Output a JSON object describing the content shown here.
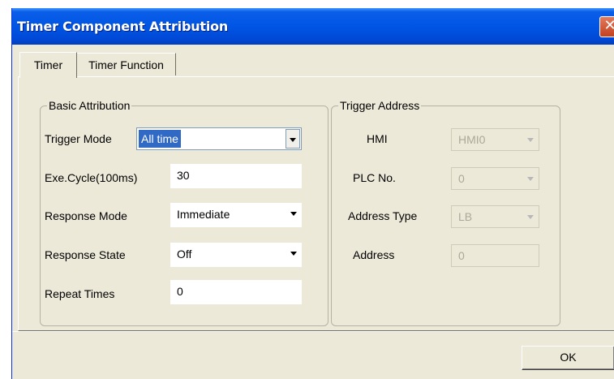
{
  "window": {
    "title": "Timer Component Attribution",
    "close_glyph": "✕"
  },
  "tabs": [
    {
      "label": "Timer",
      "active": true
    },
    {
      "label": "Timer Function",
      "active": false
    }
  ],
  "basic": {
    "group_label": "Basic Attribution",
    "trigger_mode": {
      "label": "Trigger Mode",
      "value": "All time"
    },
    "exe_cycle": {
      "label": "Exe.Cycle(100ms)",
      "value": "30"
    },
    "response_mode": {
      "label": "Response Mode",
      "value": "Immediate"
    },
    "response_state": {
      "label": "Response State",
      "value": "Off"
    },
    "repeat_times": {
      "label": "Repeat Times",
      "value": "0"
    }
  },
  "trigger": {
    "group_label": "Trigger Address",
    "hmi": {
      "label": "HMI",
      "value": "HMI0"
    },
    "plc_no": {
      "label": "PLC No.",
      "value": "0"
    },
    "address_type": {
      "label": "Address Type",
      "value": "LB"
    },
    "address": {
      "label": "Address",
      "value": "0"
    }
  },
  "ok_label": "OK",
  "colors": {
    "titlebar": "#0055e5",
    "selection": "#316ac5",
    "dialog_bg": "#ece9d8",
    "close": "#c4401e"
  },
  "icons": {
    "close": "close-icon",
    "dropdown": "chevron-down-icon"
  }
}
